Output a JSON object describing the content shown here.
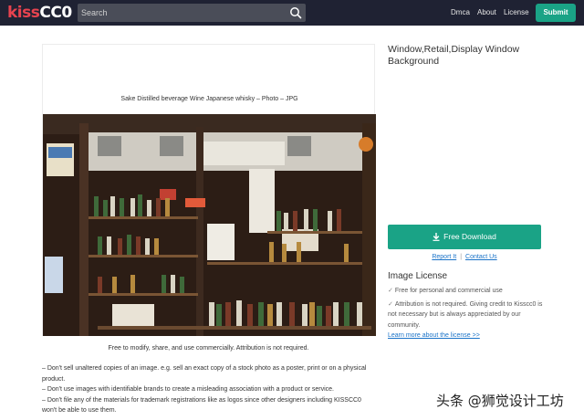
{
  "header": {
    "logo_part1": "kiss",
    "logo_part2": "CC0",
    "search_placeholder": "Search",
    "nav": [
      "Dmca",
      "About",
      "License"
    ],
    "submit_label": "Submit"
  },
  "image": {
    "caption": "Sake Distilled beverage Wine Japanese whisky – Photo – JPG",
    "photo_alt": "Japanese liquor shop window with shelves of sake bottles"
  },
  "main": {
    "free_text": "Free to modify, share, and use commercially. Attribution is not required.",
    "rules": [
      "– Don't sell unaltered copies of an image. e.g. sell an exact copy of a stock photo as a poster, print or on a physical product.",
      "– Don't use images with identifiable brands to create a misleading association with a product or service.",
      "– Don't file any of the materials for trademark registrations like as logos since other designers including KISSCC0 won't be able to use them."
    ]
  },
  "sidebar": {
    "title": "Window,Retail,Display Window Background",
    "download_label": "Free Download",
    "report_label": "Report It",
    "separator": "|",
    "contact_label": "Contact Us",
    "license_title": "Image License",
    "license_items": [
      "Free for personal and commercial use",
      "Attribution is not required. Giving credit to Kisscc0 is not necessary but is always appreciated by our community."
    ],
    "learn_more": "Learn more about the license >>"
  },
  "watermark": "头条 @狮觉设计工坊",
  "colors": {
    "header_bg": "#1f2233",
    "accent": "#1aa386",
    "logo_red": "#e8434f",
    "link": "#1a73c8"
  }
}
